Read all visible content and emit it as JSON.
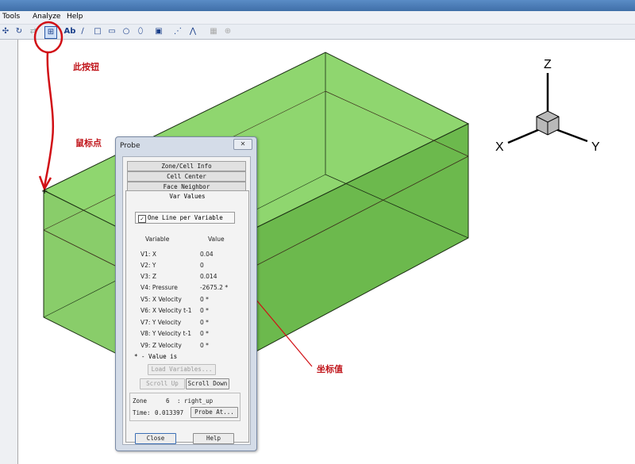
{
  "menu": {
    "tools": "Tools",
    "analyze": "Analyze",
    "help": "Help"
  },
  "toolbar": {
    "text_tool": "Ab"
  },
  "axes": {
    "z": "Z",
    "x": "X",
    "y": "Y"
  },
  "annotations": {
    "button_note": "此按钮",
    "mouse_note": "鼠标点",
    "coord_note": "坐标值"
  },
  "probe": {
    "title": "Probe",
    "close_icon": "close-icon",
    "tabs": [
      "Zone/Cell Info",
      "Cell Center",
      "Face Neighbor"
    ],
    "active_tab": "Var Values",
    "one_line_label": "One Line per Variable",
    "one_line_checked": true,
    "header_variable": "Variable",
    "header_value": "Value",
    "rows": [
      {
        "name": "V1: X",
        "value": "0.04"
      },
      {
        "name": "V2: Y",
        "value": "0"
      },
      {
        "name": "V3: Z",
        "value": "0.014"
      },
      {
        "name": "V4: Pressure",
        "value": "-2675.2 *"
      },
      {
        "name": "V5: X Velocity",
        "value": "0 *"
      },
      {
        "name": "V6: X Velocity t-1",
        "value": "0 *"
      },
      {
        "name": "V7: Y Velocity",
        "value": "0 *"
      },
      {
        "name": "V8: Y Velocity t-1",
        "value": "0 *"
      },
      {
        "name": "V9: Z Velocity",
        "value": "0 *"
      }
    ],
    "note": "* - Value is",
    "load_variables": "Load Variables...",
    "scroll_up": "Scroll Up",
    "scroll_down": "Scroll Down",
    "zone_label": "Zone",
    "zone_number": "6",
    "zone_name": ": right_up",
    "time_label": "Time:",
    "time_value": "0.013397",
    "probe_at": "Probe At...",
    "close": "Close",
    "help": "Help"
  }
}
